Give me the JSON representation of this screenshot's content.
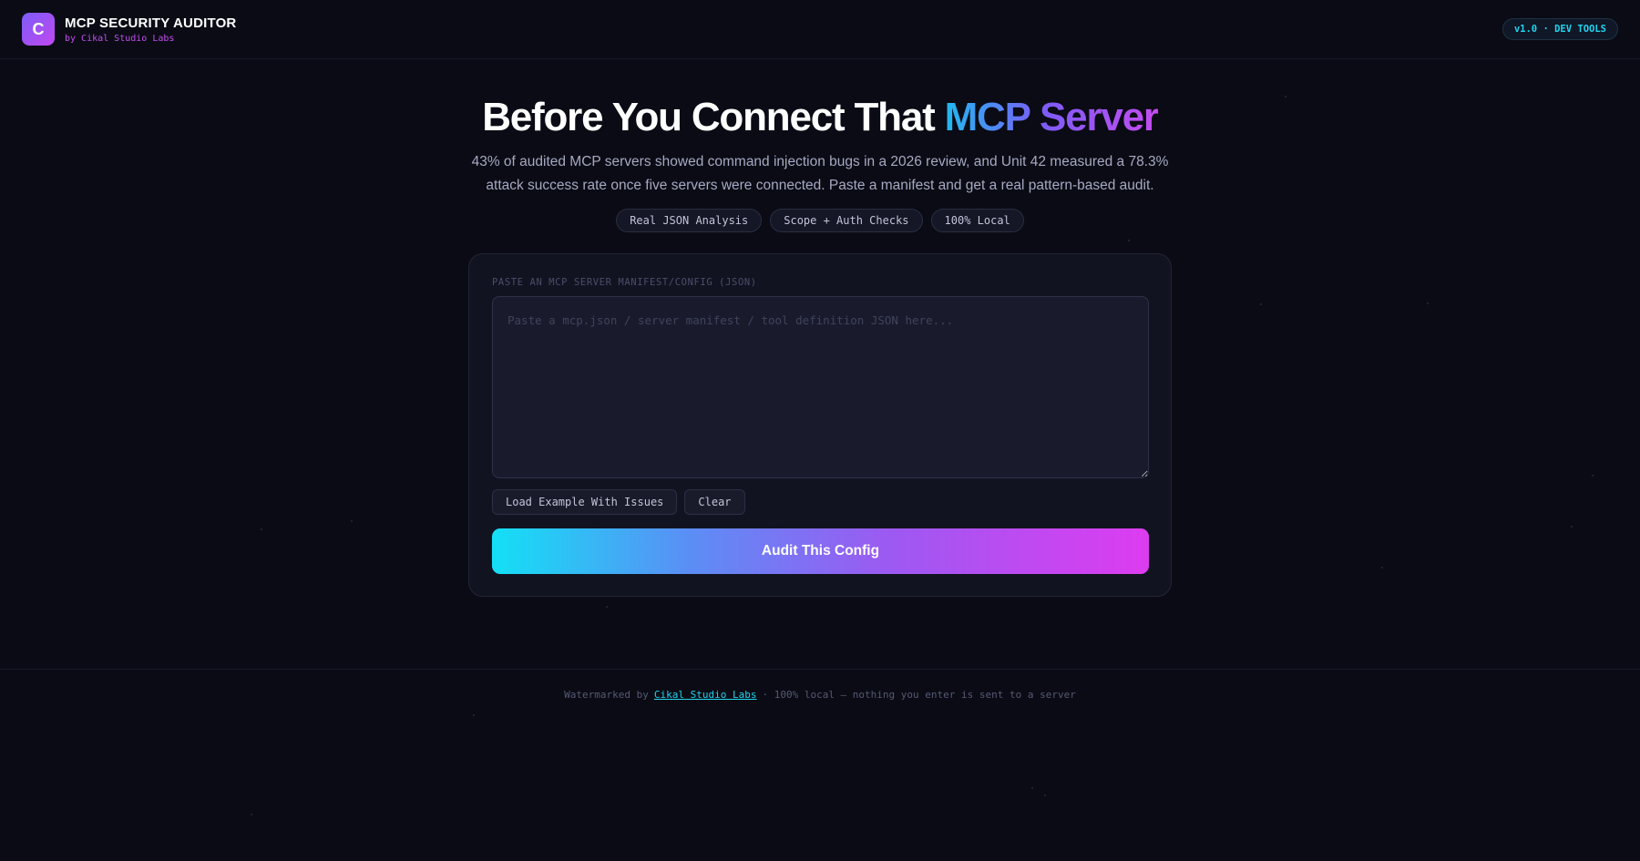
{
  "header": {
    "logo_letter": "C",
    "title": "MCP SECURITY AUDITOR",
    "subtitle": "by Cikal Studio Labs",
    "version_badge": "v1.0 · DEV TOOLS"
  },
  "hero": {
    "title_plain": "Before You Connect That ",
    "title_accent": "MCP Server",
    "description": "43% of audited MCP servers showed command injection bugs in a 2026 review, and Unit 42 measured a 78.3% attack success rate once five servers were connected. Paste a manifest and get a real pattern-based audit.",
    "chips": [
      "Real JSON Analysis",
      "Scope + Auth Checks",
      "100% Local"
    ]
  },
  "auditor": {
    "field_label": "PASTE AN MCP SERVER MANIFEST/CONFIG (JSON)",
    "input_value": "",
    "input_placeholder": "Paste a mcp.json / server manifest / tool definition JSON here...",
    "load_example_label": "Load Example With Issues",
    "clear_label": "Clear",
    "audit_label": "Audit This Config"
  },
  "footer": {
    "prefix": "Watermarked by",
    "link_text": "Cikal Studio Labs",
    "suffix": "· 100% local — nothing you enter is sent to a server"
  },
  "colors": {
    "background": "#0a0b14",
    "accent_cyan": "#22d3ee",
    "accent_purple": "#c24ef0"
  }
}
